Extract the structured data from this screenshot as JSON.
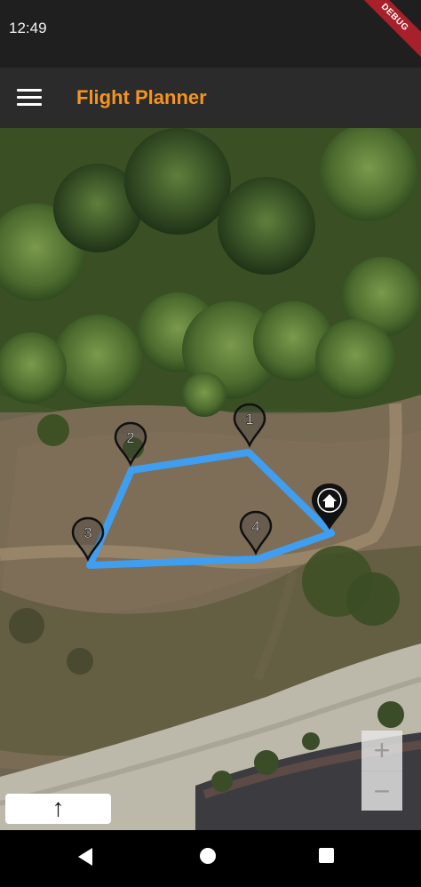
{
  "status_bar": {
    "time": "12:49",
    "debug_label": "DEBUG"
  },
  "app_bar": {
    "title": "Flight Planner",
    "title_color": "#f7941d"
  },
  "map": {
    "waypoints": [
      {
        "label": "1"
      },
      {
        "label": "2"
      },
      {
        "label": "3"
      },
      {
        "label": "4"
      }
    ],
    "route_color": "#3f9ef0",
    "home_icon": "home-icon"
  },
  "zoom": {
    "in_label": "+",
    "out_label": "−"
  },
  "compass": {
    "label": "↑"
  }
}
